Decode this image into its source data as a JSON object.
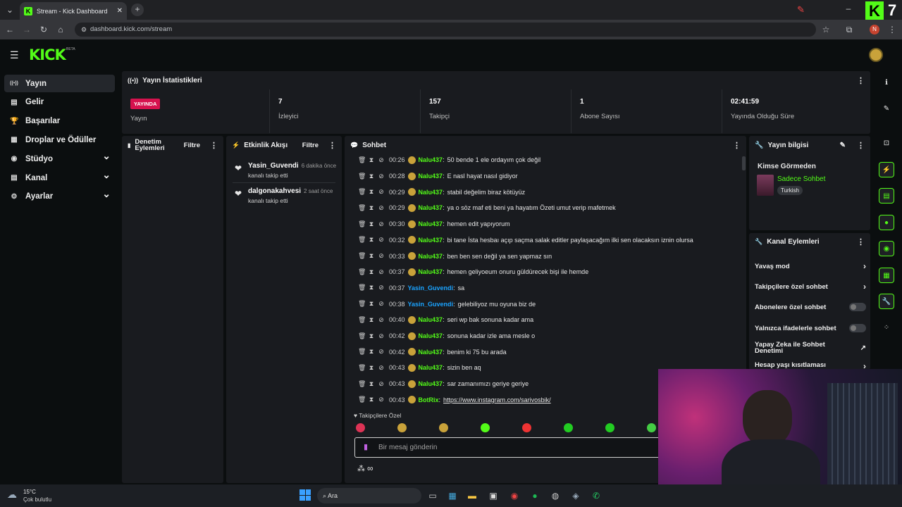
{
  "browser": {
    "tab_title": "Stream - Kick Dashboard",
    "url": "dashboard.kick.com/stream",
    "profile_initial": "N"
  },
  "colors": {
    "kick_green": "#53fc18",
    "live_red": "#d6124e",
    "nalu_color": "#53fc18",
    "yasin_color": "#1aa3ff",
    "botrix_color": "#53fc18"
  },
  "header": {
    "logo": "KICK",
    "beta": "BETA"
  },
  "sidebar": {
    "items": [
      {
        "label": "Yayın",
        "icon": "broadcast-icon",
        "active": true
      },
      {
        "label": "Gelir",
        "icon": "revenue-icon"
      },
      {
        "label": "Başarılar",
        "icon": "trophy-icon"
      },
      {
        "label": "Droplar ve Ödüller",
        "icon": "gift-icon"
      },
      {
        "label": "Stüdyo",
        "icon": "studio-icon",
        "expandable": true
      },
      {
        "label": "Kanal",
        "icon": "channel-icon",
        "expandable": true
      },
      {
        "label": "Ayarlar",
        "icon": "settings-icon",
        "expandable": true
      }
    ]
  },
  "stats": {
    "title": "Yayın İstatistikleri",
    "items": [
      {
        "value": "YAYINDA",
        "label": "Yayın"
      },
      {
        "value": "7",
        "label": "İzleyici"
      },
      {
        "value": "157",
        "label": "Takipçi"
      },
      {
        "value": "1",
        "label": "Abone Sayısı"
      },
      {
        "value": "02:41:59",
        "label": "Yayında Olduğu Süre"
      }
    ]
  },
  "moderation": {
    "title_line1": "Denetim",
    "title_line2": "Eylemleri",
    "filter": "Filtre"
  },
  "activity": {
    "title": "Etkinlik Akışı",
    "filter": "Filtre",
    "events": [
      {
        "user": "Yasin_Guvendi",
        "time": "6 dakika önce",
        "action": "kanalı takip etti"
      },
      {
        "user": "dalgonakahvesi",
        "time": "2 saat önce",
        "action": "kanalı takip etti"
      }
    ]
  },
  "chat": {
    "title": "Sohbet",
    "messages": [
      {
        "time": "00:26",
        "user": "Nalu437",
        "text": "50 bende 1 ele ordayım çok değil",
        "badge": true
      },
      {
        "time": "00:28",
        "user": "Nalu437",
        "text": "E nasl hayat nasıl gidiyor",
        "badge": true
      },
      {
        "time": "00:29",
        "user": "Nalu437",
        "text": "stabil değelim biraz kötüyüz",
        "badge": true
      },
      {
        "time": "00:29",
        "user": "Nalu437",
        "text": "ya o söz maf eti beni ya hayatım Özeti umut verip mafetmek",
        "badge": true
      },
      {
        "time": "00:30",
        "user": "Nalu437",
        "text": "hemen edit yapıyorum",
        "badge": true
      },
      {
        "time": "00:32",
        "user": "Nalu437",
        "text": "bi tane İsta hesbaı açıp saçma salak editler paylaşacağım ilki sen olacaksın iznin olursa",
        "badge": true
      },
      {
        "time": "00:33",
        "user": "Nalu437",
        "text": "ben ben sen değil ya sen yapmaz sın",
        "badge": true
      },
      {
        "time": "00:37",
        "user": "Nalu437",
        "text": "hemen geliyoeum onuru güldürecek bişi ile hemde",
        "badge": true
      },
      {
        "time": "00:37",
        "user": "Yasin_Guvendi",
        "text": "sa",
        "badge": false
      },
      {
        "time": "00:38",
        "user": "Yasin_Guvendi",
        "text": "gelebiliyoz mu oyuna biz de",
        "badge": false
      },
      {
        "time": "00:40",
        "user": "Nalu437",
        "text": "seri wp bak sonuna kadar ama",
        "badge": true
      },
      {
        "time": "00:42",
        "user": "Nalu437",
        "text": "sonuna kadar izle ama mesle o",
        "badge": true
      },
      {
        "time": "00:42",
        "user": "Nalu437",
        "text": "benim ki 75 bu arada",
        "badge": true
      },
      {
        "time": "00:43",
        "user": "Nalu437",
        "text": "sizin ben aq",
        "badge": true
      },
      {
        "time": "00:43",
        "user": "Nalu437",
        "text": "sar zamanımızı geriye geriye",
        "badge": true
      },
      {
        "time": "00:43",
        "user": "BotRix",
        "text": "https://www.instagram.com/sarivosbik/",
        "badge": true
      }
    ],
    "mode_label": "Takipçilere Özel",
    "input_placeholder": "Bir mesaj gönderin"
  },
  "stream_info": {
    "title": "Yayın bilgisi",
    "stream_title": "Kimse Görmeden",
    "category": "Sadece Sohbet",
    "tag": "Turkish"
  },
  "channel_actions": {
    "title": "Kanal Eylemleri",
    "items": [
      {
        "label": "Yavaş mod",
        "type": "link"
      },
      {
        "label": "Takipçilere özel sohbet",
        "type": "link"
      },
      {
        "label": "Abonelere özel sohbet",
        "type": "toggle"
      },
      {
        "label": "Yalnızca ifadelerle sohbet",
        "type": "toggle"
      },
      {
        "label": "Yapay Zeka ile Sohbet Denetimi",
        "type": "external"
      },
      {
        "label": "Hesap yaşı kısıtlaması",
        "type": "link"
      }
    ]
  },
  "taskbar": {
    "weather_temp": "15°C",
    "weather_desc": "Çok bulutlu",
    "search": "Ara"
  },
  "corner_badge": "7"
}
